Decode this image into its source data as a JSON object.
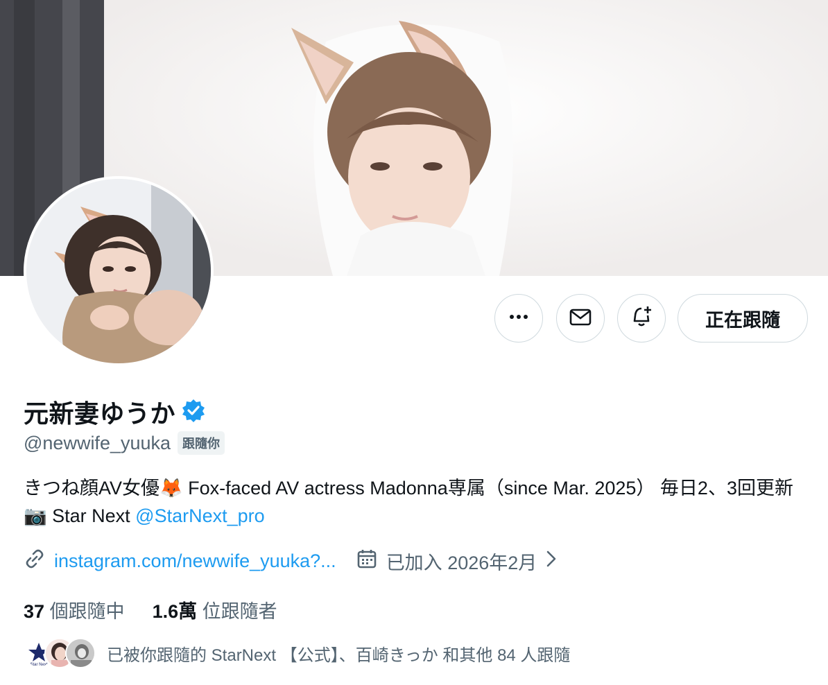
{
  "profile": {
    "display_name": "元新妻ゆうか",
    "handle": "@newwife_yuuka",
    "follows_you_badge": "跟隨你",
    "verified": true,
    "bio_text_1": "きつね顔AV女優🦊 Fox-faced AV actress Madonna専属（since Mar. 2025） 毎日2、3回更新📷 Star Next ",
    "bio_mention": "@StarNext_pro",
    "link": "instagram.com/newwife_yuuka?...",
    "joined": "已加入 2026年2月",
    "following_count": "37",
    "following_label": "個跟隨中",
    "followers_count": "1.6萬",
    "followers_label": "位跟隨者",
    "followed_by_text": "已被你跟隨的 StarNext 【公式】、百崎きっか 和其他 84 人跟隨"
  },
  "actions": {
    "more_icon": "more-icon",
    "message_icon": "mail-icon",
    "notify_icon": "bell-plus-icon",
    "follow_label": "正在跟隨"
  },
  "mini_avatar_labels": {
    "starnext": "Star Next"
  },
  "colors": {
    "accent": "#1d9bf0",
    "text": "#0f1419",
    "secondary": "#536471",
    "border": "#cfd9de"
  }
}
